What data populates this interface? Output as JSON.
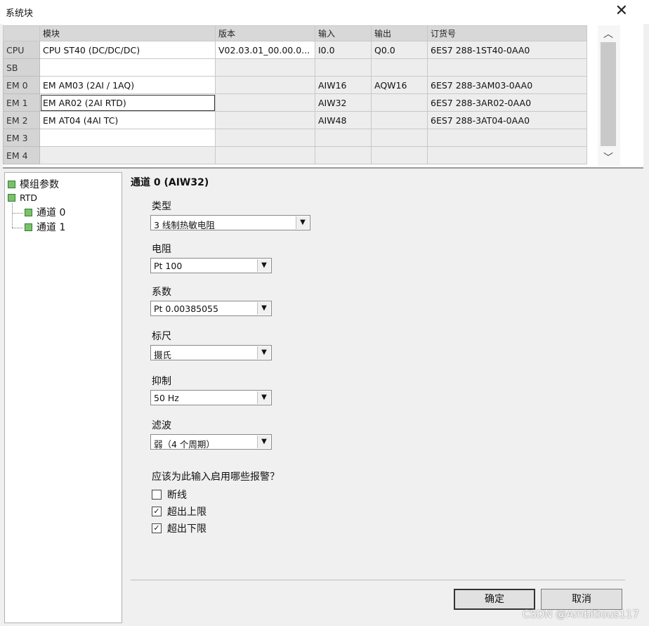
{
  "window": {
    "title": "系统块",
    "close_label": "✕"
  },
  "grid": {
    "headers": [
      "",
      "模块",
      "版本",
      "输入",
      "输出",
      "订货号"
    ],
    "rows": [
      {
        "slot": "CPU",
        "module": "CPU ST40 (DC/DC/DC)",
        "version": "V02.03.01_00.00.0...",
        "input": "I0.0",
        "output": "Q0.0",
        "order": "6ES7 288-1ST40-0AA0"
      },
      {
        "slot": "SB",
        "module": "",
        "version": "",
        "input": "",
        "output": "",
        "order": ""
      },
      {
        "slot": "EM 0",
        "module": "EM AM03 (2AI / 1AQ)",
        "version": "",
        "input": "AIW16",
        "output": "AQW16",
        "order": "6ES7 288-3AM03-0AA0"
      },
      {
        "slot": "EM 1",
        "module": "EM AR02 (2AI RTD)",
        "version": "",
        "input": "AIW32",
        "output": "",
        "order": "6ES7 288-3AR02-0AA0"
      },
      {
        "slot": "EM 2",
        "module": "EM AT04 (4AI TC)",
        "version": "",
        "input": "AIW48",
        "output": "",
        "order": "6ES7 288-3AT04-0AA0"
      },
      {
        "slot": "EM 3",
        "module": "",
        "version": "",
        "input": "",
        "output": "",
        "order": ""
      },
      {
        "slot": "EM 4",
        "module": "",
        "version": "",
        "input": "",
        "output": "",
        "order": ""
      }
    ]
  },
  "tree": {
    "items": [
      "模组参数",
      "RTD",
      "通道 0",
      "通道 1"
    ]
  },
  "panel": {
    "title": "通道 0 (AIW32)",
    "fields": [
      {
        "label": "类型",
        "value": "3 线制热敏电阻"
      },
      {
        "label": "电阻",
        "value": "Pt 100"
      },
      {
        "label": "系数",
        "value": "Pt 0.00385055"
      },
      {
        "label": "标尺",
        "value": "摄氏"
      },
      {
        "label": "抑制",
        "value": "50 Hz"
      },
      {
        "label": "滤波",
        "value": "弱（4 个周期）"
      }
    ],
    "alarm_question": "应该为此输入启用哪些报警？",
    "alarms": [
      {
        "label": "断线",
        "checked": false
      },
      {
        "label": "超出上限",
        "checked": true
      },
      {
        "label": "超出下限",
        "checked": true
      }
    ],
    "ok_label": "确定",
    "cancel_label": "取消",
    "check_mark": "✓"
  },
  "watermark": "CSDN @Ambitious117"
}
